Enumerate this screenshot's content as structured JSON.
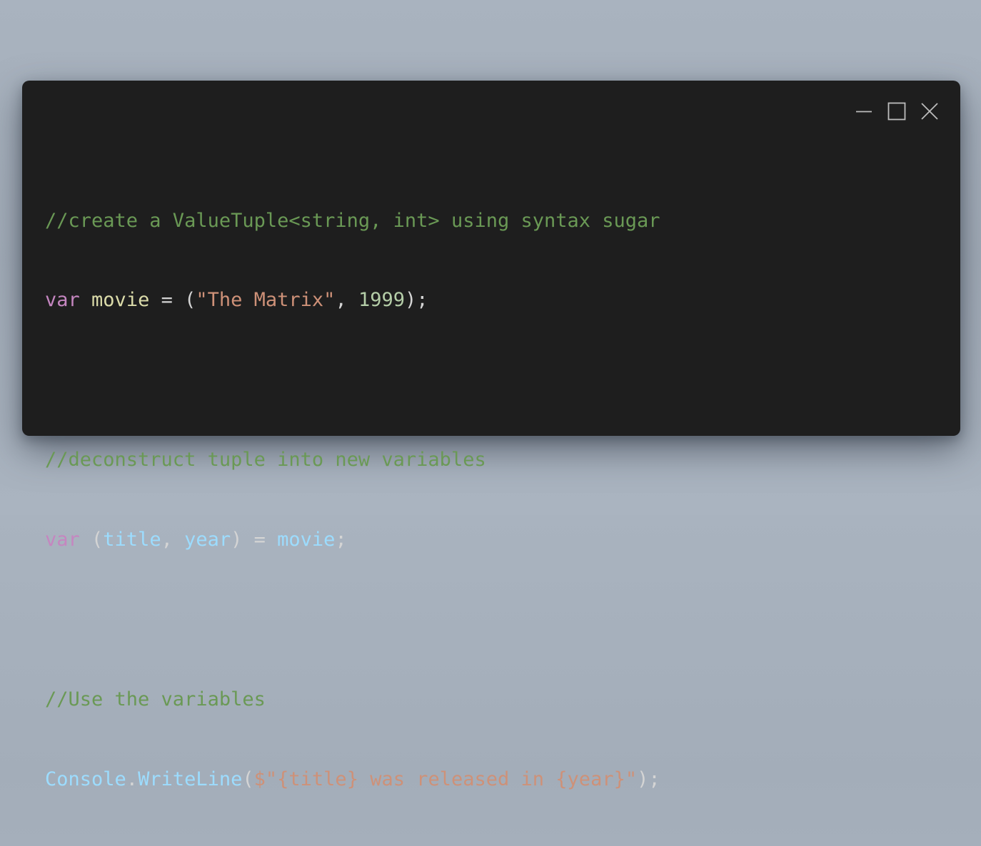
{
  "window": {
    "controls": {
      "minimize": "minimize-icon",
      "maximize": "maximize-icon",
      "close": "close-icon"
    }
  },
  "code": {
    "line1_comment": "//create a ValueTuple<string, int> using syntax sugar",
    "line2": {
      "keyword": "var",
      "name": "movie",
      "assign": " = (",
      "string": "\"The Matrix\"",
      "comma": ", ",
      "number": "1999",
      "end": ");"
    },
    "line4_comment": "//deconstruct tuple into new variables",
    "line5": {
      "keyword": "var",
      "open": " (",
      "var1": "title",
      "comma": ", ",
      "var2": "year",
      "close": ") = ",
      "source": "movie",
      "end": ";"
    },
    "line7_comment": "//Use the variables",
    "line8": {
      "class": "Console",
      "dot": ".",
      "method": "WriteLine",
      "open": "(",
      "interp": "$\"",
      "expr1": "{title}",
      "mid": " was released in ",
      "expr2": "{year}",
      "quote": "\"",
      "end": ");"
    }
  },
  "colors": {
    "background": "#1e1e1e",
    "comment": "#6a9955",
    "keyword": "#c586c0",
    "variable": "#9cdcfe",
    "string": "#ce9178",
    "number": "#b5cea8",
    "plain": "#d4d4d4"
  }
}
